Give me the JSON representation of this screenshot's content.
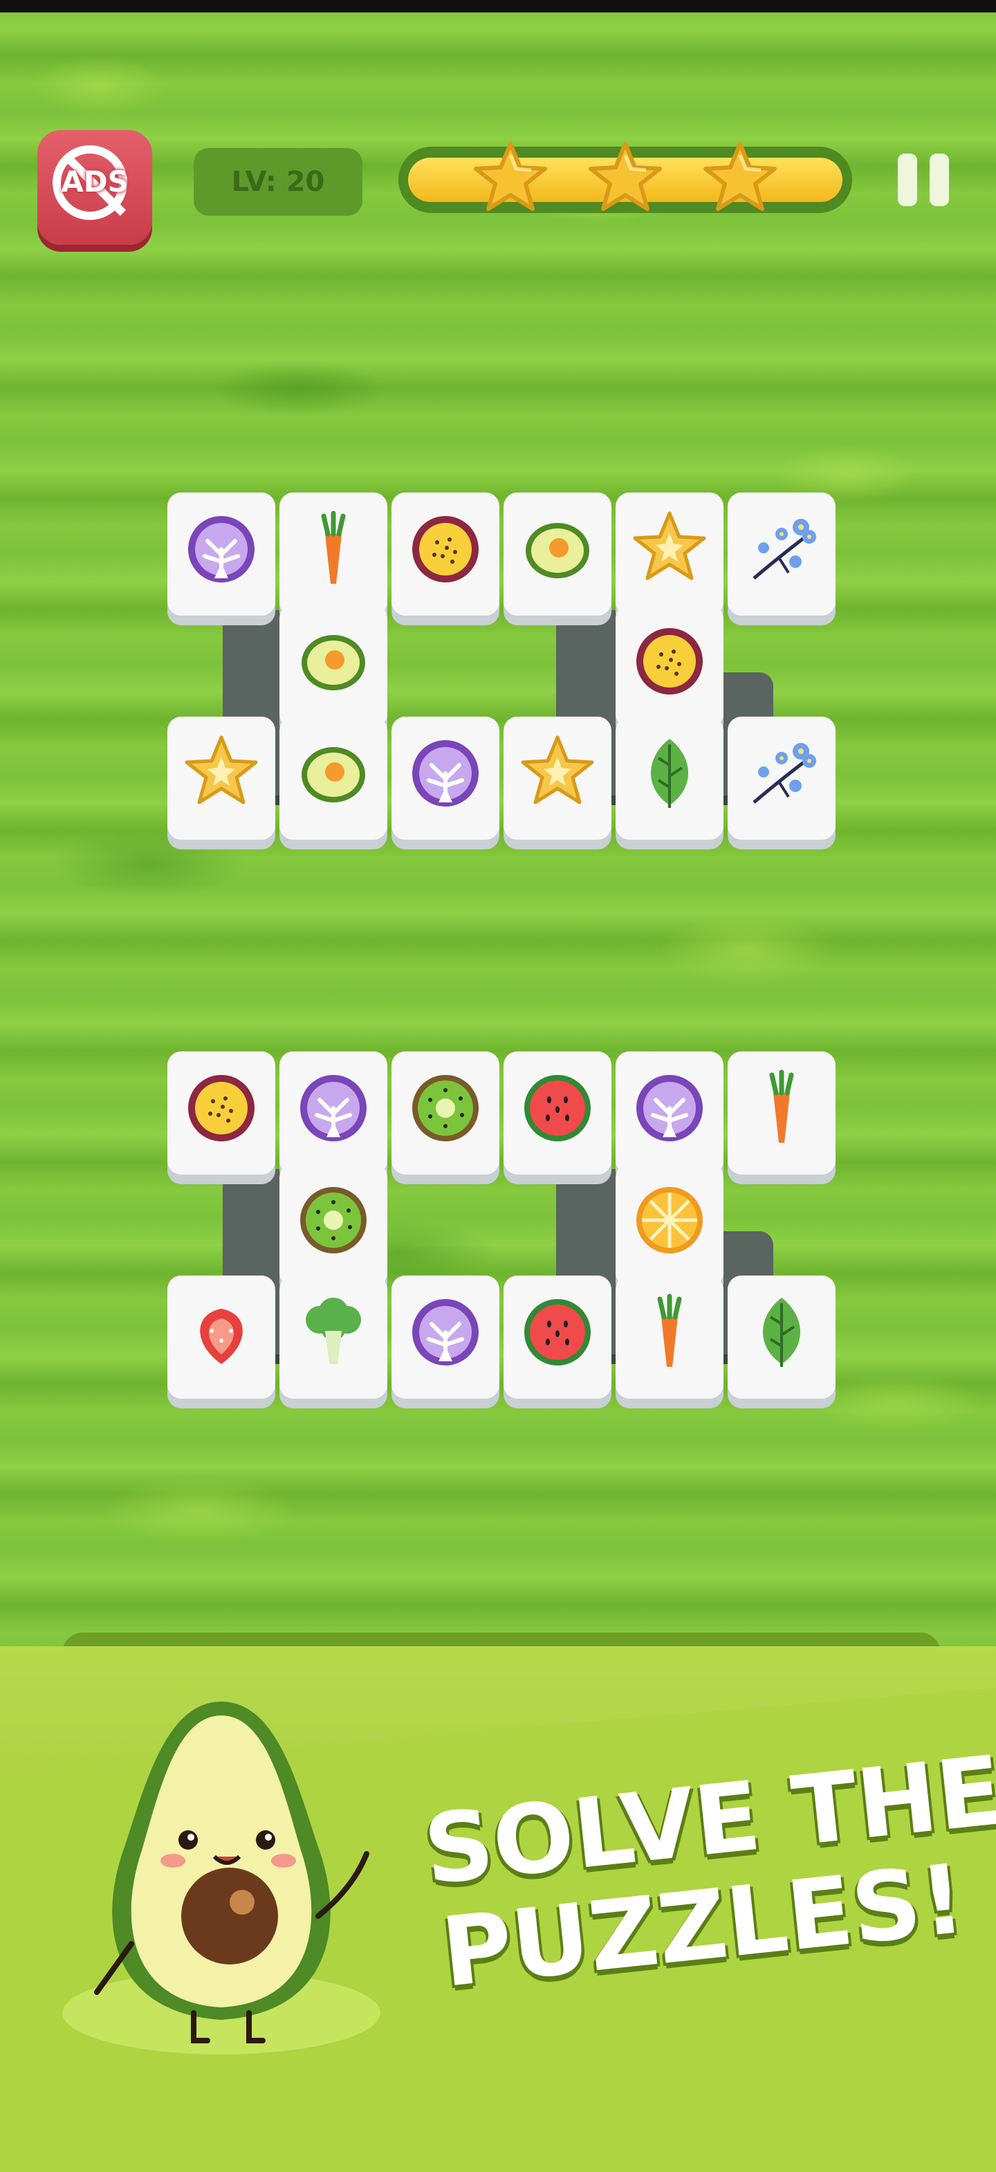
{
  "hud": {
    "ads_label": "ADS",
    "level_label": "LV: 20",
    "progress": 1.0,
    "stars_filled": 3,
    "stars_total": 3
  },
  "icons": {
    "remove_ads": "no-ads-icon",
    "pause": "pause-icon",
    "star": "star-icon"
  },
  "board": {
    "group1_tiles": [
      "cabbage",
      "carrot",
      "passion-fruit",
      "avocado",
      "starfruit",
      "flower",
      "avocado",
      "passion-fruit",
      "starfruit",
      "avocado",
      "cabbage",
      "starfruit",
      "leaf",
      "flower"
    ],
    "group2_tiles": [
      "passion-fruit",
      "cabbage",
      "kiwi",
      "watermelon",
      "cabbage",
      "carrot",
      "kiwi",
      "orange",
      "strawberry",
      "broccoli",
      "cabbage",
      "watermelon",
      "carrot",
      "leaf"
    ]
  },
  "promo": {
    "line1": "SOLVE THE",
    "line2": "PUZZLES!",
    "mascot": "avocado-mascot"
  },
  "colors": {
    "grass": "#7cc23a",
    "ads_button": "#d94a56",
    "progress_fill": "#f8cd2f",
    "star": "#f6c232",
    "tile": "#f7f7f7",
    "panel": "#aed441"
  }
}
